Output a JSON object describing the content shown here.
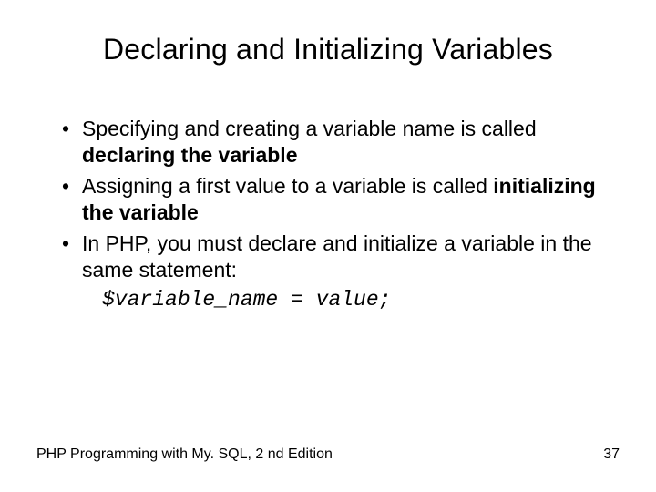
{
  "title": "Declaring and Initializing Variables",
  "bullets": {
    "b1": {
      "pre": "Specifying and creating a variable name is called ",
      "bold": "declaring the variable"
    },
    "b2": {
      "pre": "Assigning a first value to a variable is called ",
      "bold": "initializing the variable"
    },
    "b3": {
      "text": "In PHP, you must declare and initialize a variable in the same statement:"
    }
  },
  "code": "$variable_name = value;",
  "footer": {
    "source": "PHP Programming with My. SQL, 2 nd Edition",
    "page": "37"
  }
}
